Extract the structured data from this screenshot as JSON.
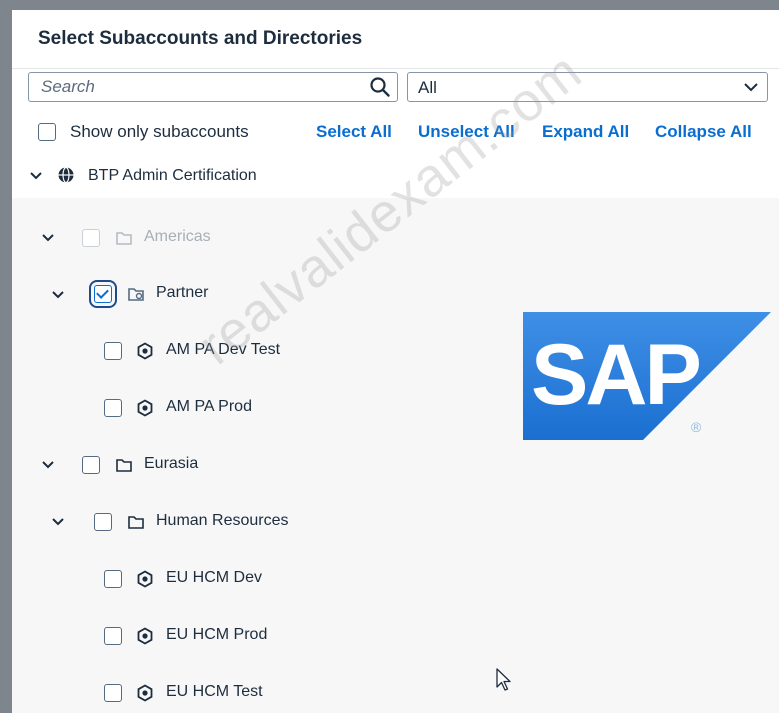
{
  "dialog": {
    "title": "Select Subaccounts and Directories"
  },
  "search": {
    "placeholder": "Search",
    "value": ""
  },
  "filter": {
    "selected": "All"
  },
  "toolbar": {
    "show_only_subaccounts": "Show only subaccounts",
    "select_all": "Select All",
    "unselect_all": "Unselect All",
    "expand_all": "Expand All",
    "collapse_all": "Collapse All"
  },
  "tree": {
    "root": {
      "label": "BTP Admin Certification"
    },
    "items": [
      {
        "label": "Americas",
        "type": "directory",
        "state": "disabled"
      },
      {
        "label": "Partner",
        "type": "directory",
        "state": "checked"
      },
      {
        "label": "AM PA Dev Test",
        "type": "subaccount",
        "state": "unchecked"
      },
      {
        "label": "AM PA Prod",
        "type": "subaccount",
        "state": "unchecked"
      },
      {
        "label": "Eurasia",
        "type": "directory",
        "state": "unchecked"
      },
      {
        "label": "Human Resources",
        "type": "directory",
        "state": "unchecked"
      },
      {
        "label": "EU HCM Dev",
        "type": "subaccount",
        "state": "unchecked"
      },
      {
        "label": "EU HCM Prod",
        "type": "subaccount",
        "state": "unchecked"
      },
      {
        "label": "EU HCM Test",
        "type": "subaccount",
        "state": "unchecked"
      }
    ]
  },
  "overlay": {
    "logo_text": "SAP",
    "logo_mark": "®",
    "watermark": "realvalidexam.com"
  },
  "colors": {
    "link": "#0a6ed1",
    "text": "#1d2d3e",
    "sap_blue": "#1a6fd0"
  }
}
